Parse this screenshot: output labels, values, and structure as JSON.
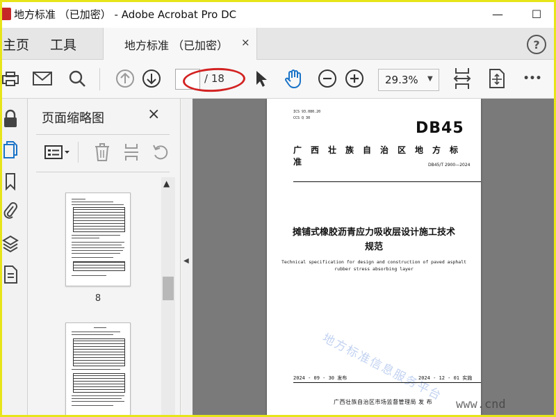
{
  "window": {
    "title": "地方标准  （已加密） - Adobe Acrobat Pro DC",
    "minimize": "—",
    "maximize": "☐"
  },
  "tabs": {
    "home": "主页",
    "tools": "工具",
    "document": "地方标准  （已加密）",
    "close": "×",
    "help": "?"
  },
  "toolbar": {
    "current_page": "",
    "page_total": "/ 18",
    "zoom": "29.3%",
    "zoom_arrow": "▼",
    "more": "•••"
  },
  "thumbnail_panel": {
    "title": "页面缩略图",
    "close": "×",
    "page_labels": [
      "8"
    ],
    "scroll_up": "▲"
  },
  "collapse_arrow": "◀",
  "document_page": {
    "ics": "ICS  93.080.20",
    "ccs": "CCS  Q 30",
    "logo": "DB45",
    "org": "广西壮族自治区地方标准",
    "code": "DB45/T 2900—2024",
    "title_line1": "摊铺式橡胶沥青应力吸收层设计施工技术",
    "title_line2": "规范",
    "english_line1": "Technical specification for design and construction of paved asphalt",
    "english_line2": "rubber stress absorbing layer",
    "watermark": "地方标准信息服务平台",
    "publish_date": "2024 - 09 - 30 发布",
    "effective_date": "2024 - 12 - 01 实施",
    "issuer": "广西壮族自治区市场监督管理局    发 布"
  },
  "corner_watermark": "www.cnd",
  "colors": {
    "frame": "#e8e41a",
    "annotation": "#d32222",
    "acrobat_red": "#c62828",
    "accent_blue": "#1a73c7",
    "viewer_gray": "#7a7a7a"
  },
  "icons": [
    "print-icon",
    "mail-icon",
    "search-icon",
    "page-up-icon",
    "page-down-icon",
    "select-cursor-icon",
    "hand-tool-icon",
    "zoom-out-icon",
    "zoom-in-icon",
    "fit-width-icon",
    "fit-page-icon",
    "more-icon",
    "lock-icon",
    "page-thumbnail-icon",
    "bookmark-icon",
    "attachment-icon",
    "layers-icon",
    "content-icon",
    "options-icon",
    "trash-icon",
    "extract-icon",
    "rotate-icon"
  ]
}
